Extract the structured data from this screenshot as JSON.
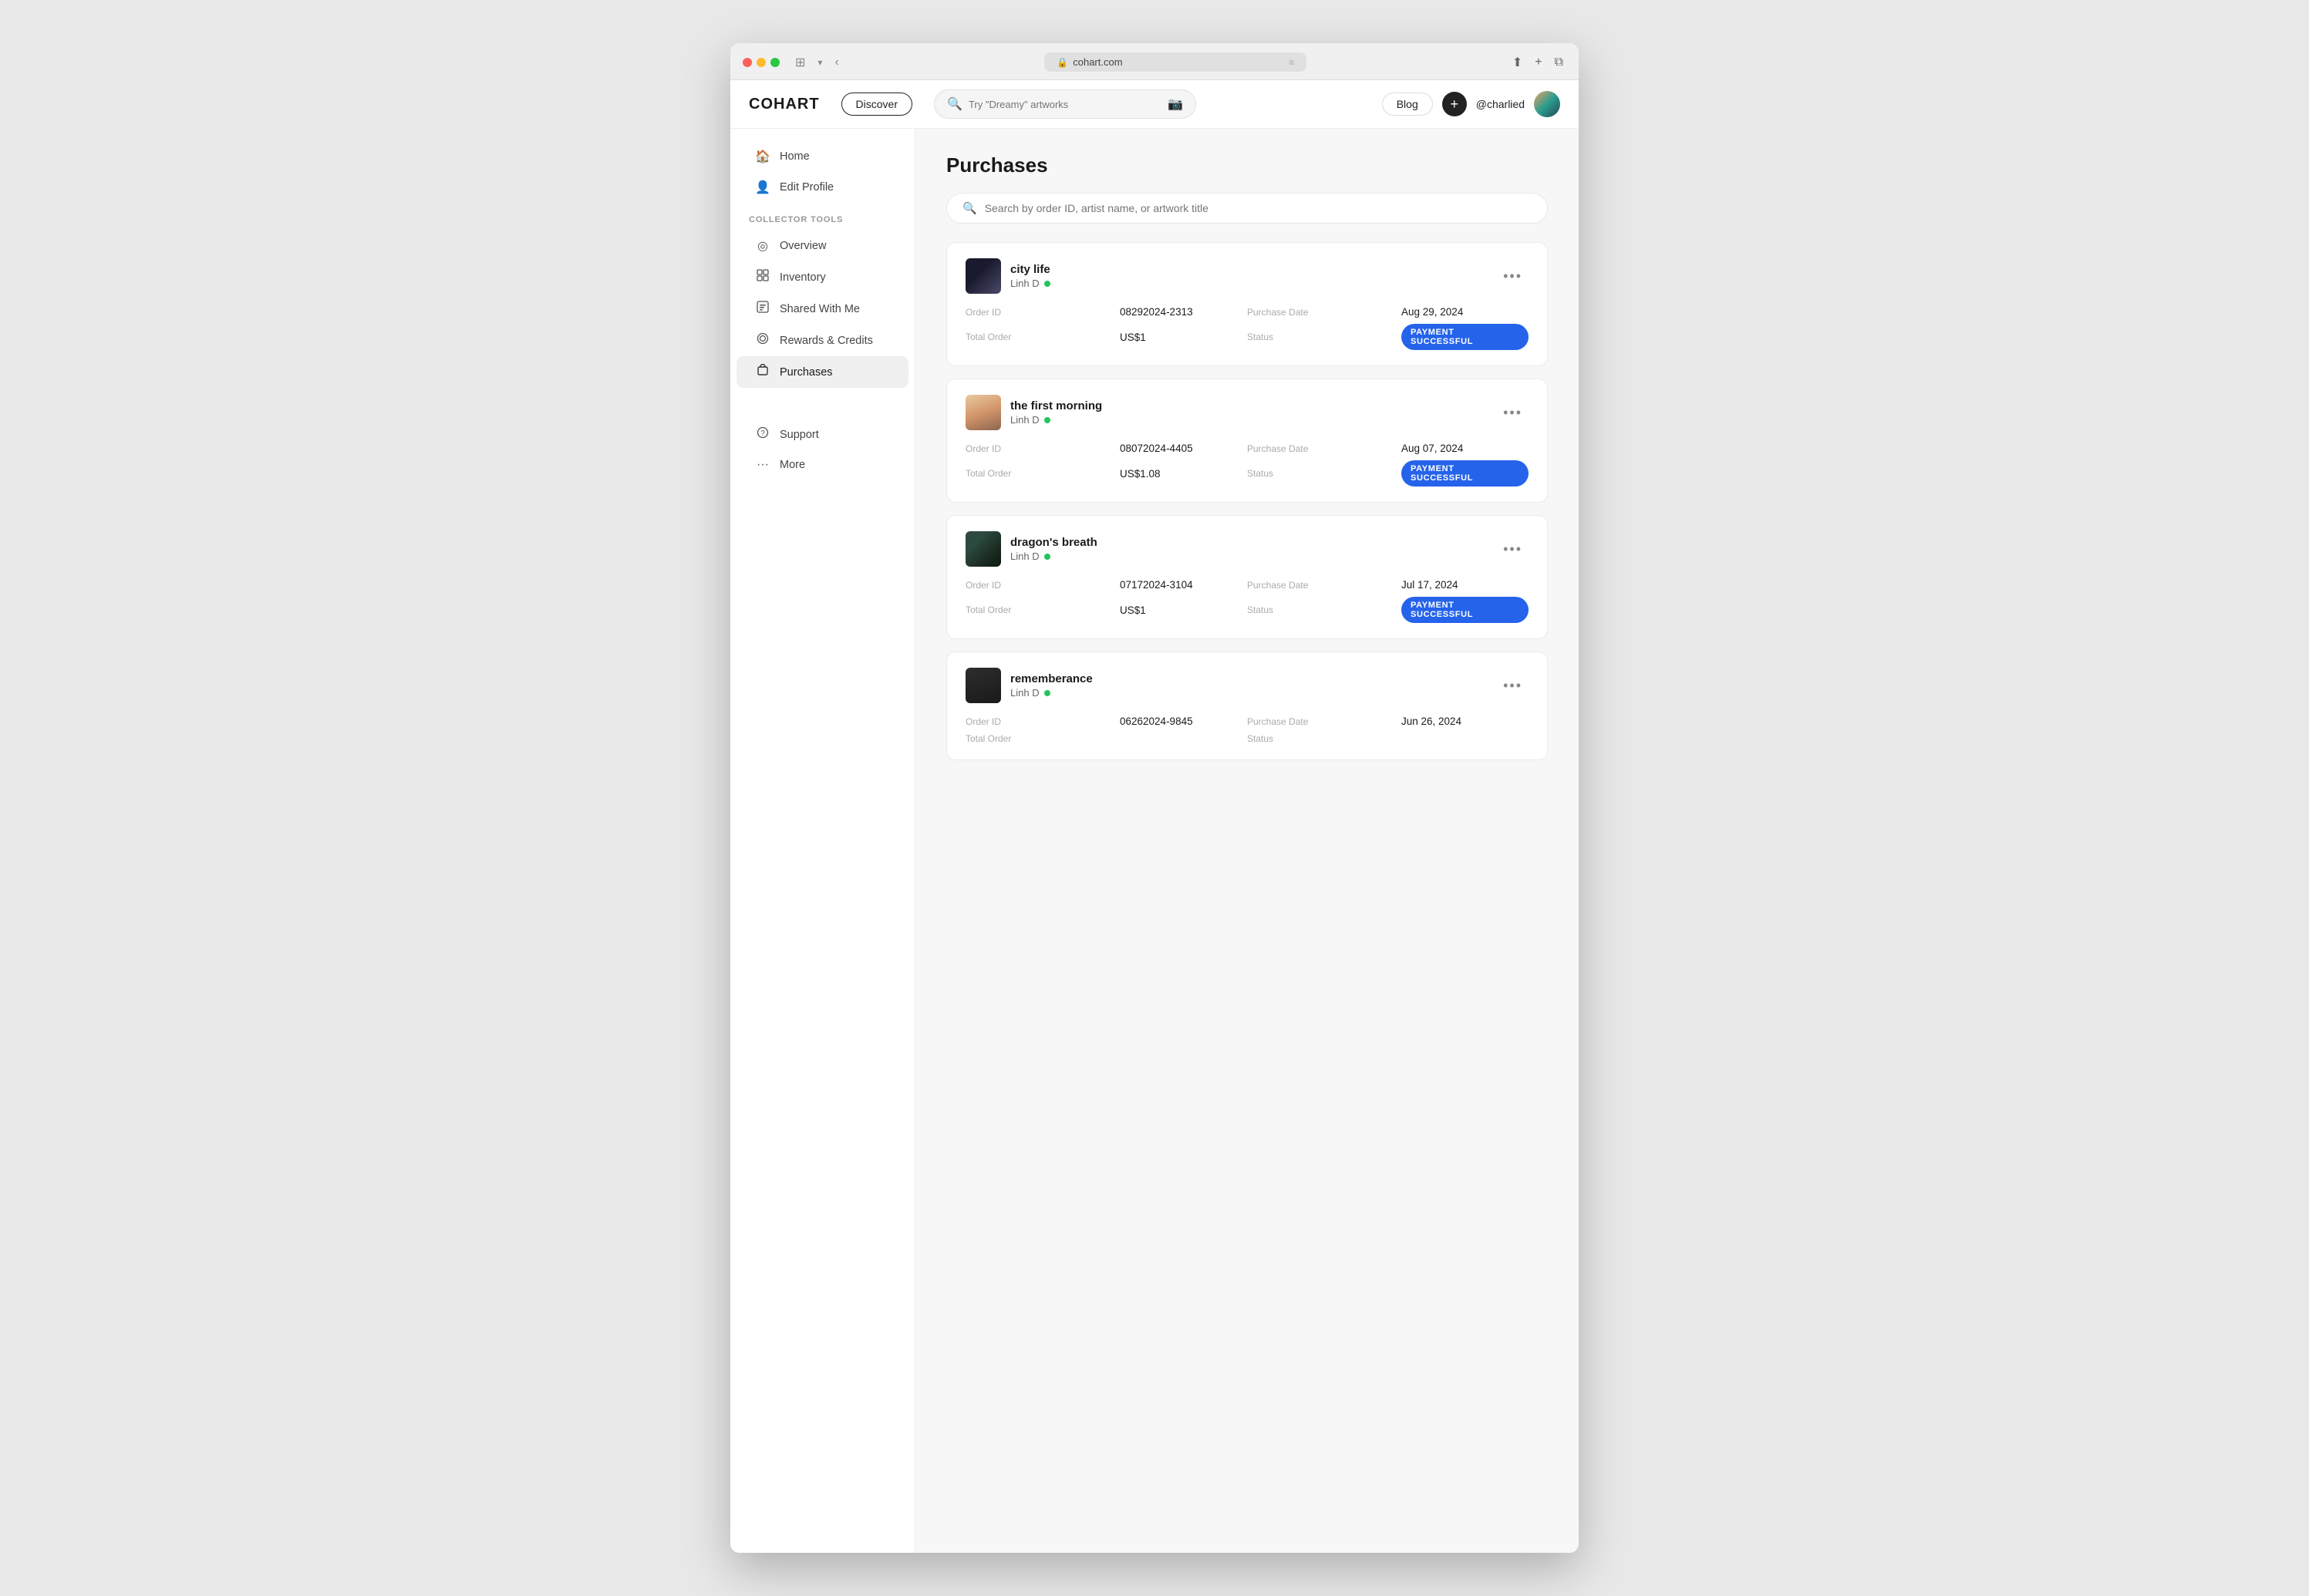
{
  "browser": {
    "url": "cohart.com",
    "lock_icon": "🔒"
  },
  "nav": {
    "logo": "COHART",
    "discover_label": "Discover",
    "search_placeholder": "Try \"Dreamy\" artworks",
    "blog_label": "Blog",
    "plus_label": "+",
    "username": "@charlied"
  },
  "sidebar": {
    "main_items": [
      {
        "id": "home",
        "label": "Home",
        "icon": "⌂"
      },
      {
        "id": "edit-profile",
        "label": "Edit Profile",
        "icon": "○"
      }
    ],
    "section_label": "COLLECTOR TOOLS",
    "collector_items": [
      {
        "id": "overview",
        "label": "Overview",
        "icon": "◎"
      },
      {
        "id": "inventory",
        "label": "Inventory",
        "icon": "▦"
      },
      {
        "id": "shared-with-me",
        "label": "Shared With Me",
        "icon": "▣"
      },
      {
        "id": "rewards-credits",
        "label": "Rewards & Credits",
        "icon": "◈"
      },
      {
        "id": "purchases",
        "label": "Purchases",
        "icon": "◫",
        "active": true
      }
    ],
    "bottom_items": [
      {
        "id": "support",
        "label": "Support",
        "icon": "?"
      },
      {
        "id": "more",
        "label": "More",
        "icon": "···"
      }
    ]
  },
  "content": {
    "page_title": "Purchases",
    "search_placeholder": "Search by order ID, artist name, or artwork title",
    "purchases": [
      {
        "id": "purchase-1",
        "artwork_title": "city life",
        "artist_name": "Linh D",
        "artist_online": true,
        "order_id_label": "Order ID",
        "order_id": "08292024-2313",
        "purchase_date_label": "Purchase Date",
        "purchase_date": "Aug 29, 2024",
        "total_label": "Total Order",
        "total": "US$1",
        "status_label": "Status",
        "status": "PAYMENT SUCCESSFUL",
        "thumb_class": "artwork-thumb-1"
      },
      {
        "id": "purchase-2",
        "artwork_title": "the first morning",
        "artist_name": "Linh D",
        "artist_online": true,
        "order_id_label": "Order ID",
        "order_id": "08072024-4405",
        "purchase_date_label": "Purchase Date",
        "purchase_date": "Aug 07, 2024",
        "total_label": "Total Order",
        "total": "US$1.08",
        "status_label": "Status",
        "status": "PAYMENT SUCCESSFUL",
        "thumb_class": "artwork-thumb-2"
      },
      {
        "id": "purchase-3",
        "artwork_title": "dragon's breath",
        "artist_name": "Linh D",
        "artist_online": true,
        "order_id_label": "Order ID",
        "order_id": "07172024-3104",
        "purchase_date_label": "Purchase Date",
        "purchase_date": "Jul 17, 2024",
        "total_label": "Total Order",
        "total": "US$1",
        "status_label": "Status",
        "status": "PAYMENT SUCCESSFUL",
        "thumb_class": "artwork-thumb-3"
      },
      {
        "id": "purchase-4",
        "artwork_title": "rememberance",
        "artist_name": "Linh D",
        "artist_online": true,
        "order_id_label": "Order ID",
        "order_id": "06262024-9845",
        "purchase_date_label": "Purchase Date",
        "purchase_date": "Jun 26, 2024",
        "total_label": "Total Order",
        "total": "",
        "status_label": "Status",
        "status": "",
        "thumb_class": "artwork-thumb-4"
      }
    ]
  }
}
